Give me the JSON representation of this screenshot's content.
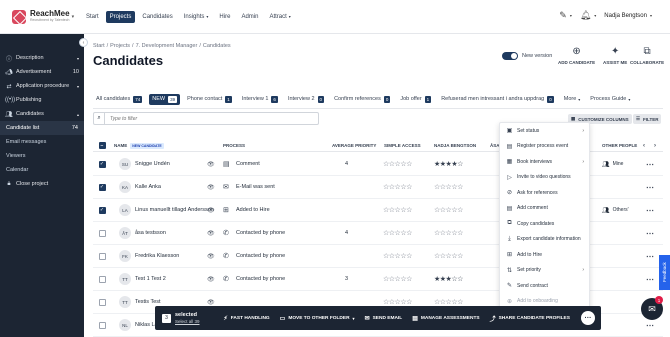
{
  "brand": {
    "name": "ReachMee",
    "tagline": "Recruitment by Talentech"
  },
  "nav": [
    {
      "label": "Start",
      "active": false,
      "has_menu": false
    },
    {
      "label": "Projects",
      "active": true,
      "has_menu": false
    },
    {
      "label": "Candidates",
      "active": false,
      "has_menu": false
    },
    {
      "label": "Insights",
      "active": false,
      "has_menu": true
    },
    {
      "label": "Hire",
      "active": false,
      "has_menu": false
    },
    {
      "label": "Admin",
      "active": false,
      "has_menu": false
    },
    {
      "label": "Attract",
      "active": false,
      "has_menu": true
    }
  ],
  "user": {
    "name": "Nadja Bengtson"
  },
  "sidebar": {
    "items": [
      {
        "label": "Description",
        "icon": "info-icon",
        "count": "",
        "arrow": "▾"
      },
      {
        "label": "Advertisement",
        "icon": "megaphone-icon",
        "count": "10",
        "arrow": ""
      },
      {
        "label": "Application procedure",
        "icon": "flow-icon",
        "count": "",
        "arrow": "▾"
      },
      {
        "label": "Publishing",
        "icon": "broadcast-icon",
        "count": "",
        "arrow": ""
      },
      {
        "label": "Candidates",
        "icon": "people-icon",
        "count": "",
        "arrow": "▴"
      }
    ],
    "subitems": [
      {
        "label": "Candidate list",
        "count": "74",
        "active": true
      },
      {
        "label": "Email messages",
        "count": "",
        "active": false
      },
      {
        "label": "Viewers",
        "count": "",
        "active": false
      },
      {
        "label": "Calendar",
        "count": "",
        "active": false
      }
    ],
    "close_project": {
      "label": "Close project",
      "icon": "lock-icon"
    }
  },
  "breadcrumb": [
    "Start",
    "Projects",
    "7. Development Manager",
    "Candidates"
  ],
  "page_title": "Candidates",
  "new_version": {
    "label": "New version",
    "on": true
  },
  "actions": [
    {
      "label": "ADD CANDIDATE",
      "icon": "plus-circle-icon"
    },
    {
      "label": "ASSIST ME",
      "icon": "sparkle-icon"
    },
    {
      "label": "COLLABORATE",
      "icon": "collaborate-icon"
    }
  ],
  "tabs": [
    {
      "label": "All candidates",
      "count": "74",
      "active": false
    },
    {
      "label": "NEW",
      "count": "39",
      "active": true
    },
    {
      "label": "Phone contact",
      "count": "1",
      "active": false
    },
    {
      "label": "Interview 1",
      "count": "6",
      "active": false
    },
    {
      "label": "Interview 2",
      "count": "0",
      "active": false
    },
    {
      "label": "Confirm references",
      "count": "0",
      "active": false
    },
    {
      "label": "Job offer",
      "count": "1",
      "active": false
    },
    {
      "label": "Refuserad men intressant i andra uppdrag",
      "count": "0",
      "active": false
    }
  ],
  "tab_more": "More",
  "process_guide": "Process Guide",
  "filter": {
    "placeholder": "Type to filter"
  },
  "customize_columns": "CUSTOMIZE COLUMNS",
  "filter_button": "FILTER",
  "columns": {
    "name": "NAME",
    "new_badge": "NEW CANDIDATE",
    "process": "PROCESS",
    "avg_priority": "AVERAGE PRIORITY",
    "simple_access": "SIMPLE ACCESS",
    "nadja": "NADJA BENGTSON",
    "other_people": "OTHER PEOPLE",
    "truncated": "ÅSA"
  },
  "rows": [
    {
      "initials": "SU",
      "name": "Snigge Undén",
      "checked": true,
      "process_icon": "comment-icon",
      "process": "Comment",
      "priority": "4",
      "simple_stars": 0,
      "nadja_stars": 4,
      "other": "Mine"
    },
    {
      "initials": "KA",
      "name": "Kalle Anka",
      "checked": true,
      "process_icon": "email-icon",
      "process": "E-Mail was sent",
      "priority": "",
      "simple_stars": 0,
      "nadja_stars": 0,
      "other": ""
    },
    {
      "initials": "LA",
      "name": "Linus manuellt tillagd Andersson",
      "checked": true,
      "process_icon": "hire-icon",
      "process": "Added to Hire",
      "priority": "",
      "simple_stars": 0,
      "nadja_stars": 0,
      "other": "Others'"
    },
    {
      "initials": "ÅT",
      "name": "åsa testsson",
      "checked": false,
      "process_icon": "phone-icon",
      "process": "Contacted by phone",
      "priority": "4",
      "simple_stars": 0,
      "nadja_stars": 0,
      "other": ""
    },
    {
      "initials": "FK",
      "name": "Fredrika Klaesson",
      "checked": false,
      "process_icon": "phone-icon",
      "process": "Contacted by phone",
      "priority": "",
      "simple_stars": 0,
      "nadja_stars": 0,
      "other": ""
    },
    {
      "initials": "TT",
      "name": "Test 1 Test 2",
      "checked": false,
      "process_icon": "phone-icon",
      "process": "Contacted by phone",
      "priority": "3",
      "simple_stars": 0,
      "nadja_stars": 3,
      "other": ""
    },
    {
      "initials": "TT",
      "name": "Testis Test",
      "checked": false,
      "process_icon": "",
      "process": "",
      "priority": "",
      "simple_stars": 0,
      "nadja_stars": 0,
      "other": ""
    },
    {
      "initials": "NL",
      "name": "Niklas Langvig",
      "checked": false,
      "process_icon": "email-icon",
      "process": "E-Mail was sent",
      "priority": "",
      "simple_stars": 0,
      "nadja_stars": 0,
      "other": ""
    }
  ],
  "context_menu": [
    {
      "label": "Set status",
      "icon": "status-icon",
      "submenu": true,
      "disabled": false
    },
    {
      "label": "Register process event",
      "icon": "register-icon",
      "submenu": false,
      "disabled": false
    },
    {
      "label": "Book interviews",
      "icon": "calendar-icon",
      "submenu": true,
      "disabled": false
    },
    {
      "label": "Invite to video questions",
      "icon": "video-icon",
      "submenu": false,
      "disabled": false
    },
    {
      "label": "Ask for references",
      "icon": "references-icon",
      "submenu": false,
      "disabled": false
    },
    {
      "label": "Add comment",
      "icon": "comment-icon",
      "submenu": false,
      "disabled": false
    },
    {
      "label": "Copy candidates",
      "icon": "copy-icon",
      "submenu": false,
      "disabled": false
    },
    {
      "label": "Export candidate information",
      "icon": "export-icon",
      "submenu": false,
      "disabled": false
    },
    {
      "label": "Add to Hire",
      "icon": "hire-icon",
      "submenu": false,
      "disabled": false
    },
    {
      "label": "Set priority",
      "icon": "priority-icon",
      "submenu": true,
      "disabled": false
    },
    {
      "label": "Send contract",
      "icon": "contract-icon",
      "submenu": false,
      "disabled": false
    },
    {
      "label": "Add to onboarding",
      "icon": "onboarding-icon",
      "submenu": false,
      "disabled": true
    }
  ],
  "bulk": {
    "count": "3",
    "selected_label": "selected",
    "select_all": "Select all 39",
    "actions": [
      {
        "label": "FAST HANDLING",
        "icon": "bolt-icon",
        "dropdown": false
      },
      {
        "label": "MOVE TO OTHER FOLDER",
        "icon": "folder-icon",
        "dropdown": true
      },
      {
        "label": "SEND EMAIL",
        "icon": "email-icon",
        "dropdown": false
      },
      {
        "label": "MANAGE ASSESSMENTS",
        "icon": "assessment-icon",
        "dropdown": false
      },
      {
        "label": "SHARE CANDIDATE PROFILES",
        "icon": "share-icon",
        "dropdown": false
      }
    ]
  },
  "feedback": "Feedback",
  "chat_badge": "1"
}
